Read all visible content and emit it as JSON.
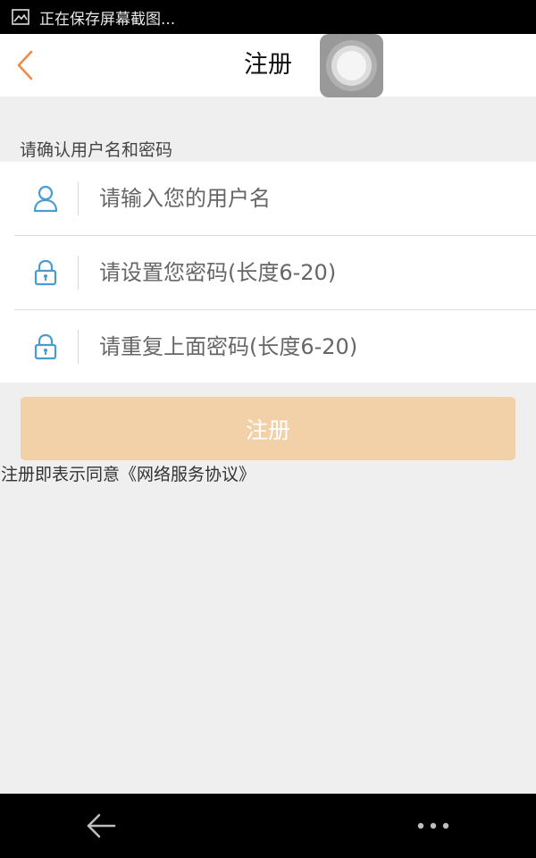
{
  "status_bar": {
    "text": "正在保存屏幕截图..."
  },
  "header": {
    "title": "注册"
  },
  "form": {
    "section_label": "请确认用户名和密码",
    "username": {
      "placeholder": "请输入您的用户名",
      "value": ""
    },
    "password": {
      "placeholder": "请设置您密码(长度6-20)",
      "value": ""
    },
    "password_repeat": {
      "placeholder": "请重复上面密码(长度6-20)",
      "value": ""
    }
  },
  "register_button": {
    "label": "注册"
  },
  "agreement": {
    "text": "注册即表示同意《网络服务协议》"
  },
  "icons": {
    "status": "screenshot-image-icon",
    "back": "chevron-left-icon",
    "user": "user-icon",
    "lock": "lock-icon",
    "nav_back": "arrow-left-icon",
    "nav_more": "more-dots-icon"
  },
  "colors": {
    "accent": "#f08a4b",
    "icon_blue": "#4a9bd0",
    "button_disabled": "#f3d1a8",
    "background": "#efefef"
  }
}
